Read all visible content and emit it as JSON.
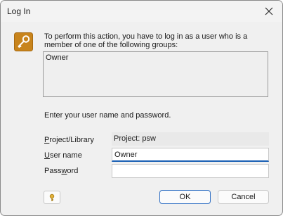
{
  "window": {
    "title": "Log In",
    "close_icon": "close-icon"
  },
  "intro_text": "To perform this action, you have to log in as a user who is a member of one of the following groups:",
  "groups": [
    "Owner"
  ],
  "enter_text": "Enter your user name and password.",
  "fields": {
    "project_label": "Project/Library",
    "project_value": "Project: psw",
    "username_label": "User name",
    "username_value": "Owner",
    "password_label": "Password",
    "password_value": ""
  },
  "buttons": {
    "ok": "OK",
    "cancel": "Cancel"
  },
  "colors": {
    "key_icon_bg": "#c8841c",
    "focus_underline": "#1a5fb4"
  }
}
